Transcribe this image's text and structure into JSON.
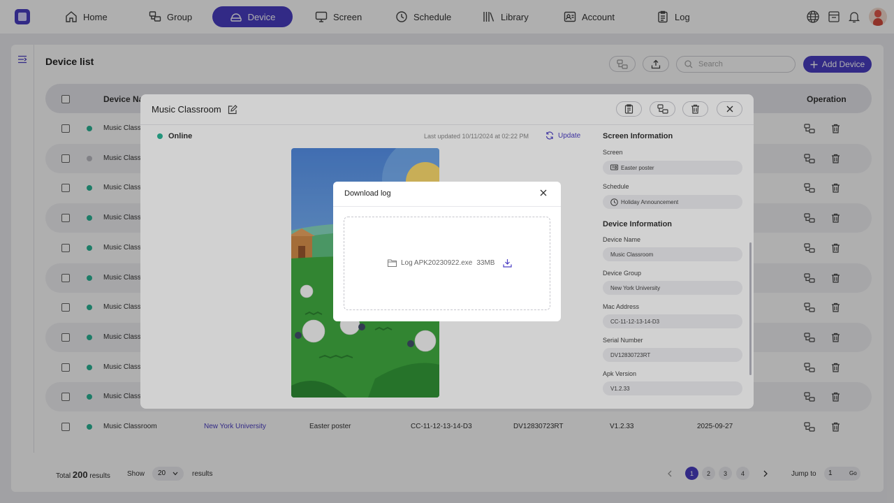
{
  "nav": {
    "items": [
      {
        "label": "Home",
        "icon": "home-icon"
      },
      {
        "label": "Group",
        "icon": "group-icon"
      },
      {
        "label": "Device",
        "icon": "device-icon",
        "active": true
      },
      {
        "label": "Screen",
        "icon": "screen-icon"
      },
      {
        "label": "Schedule",
        "icon": "schedule-icon"
      },
      {
        "label": "Library",
        "icon": "library-icon"
      },
      {
        "label": "Account",
        "icon": "account-icon"
      },
      {
        "label": "Log",
        "icon": "log-icon"
      }
    ],
    "right_icons": [
      "globe-icon",
      "store-icon",
      "bell-icon",
      "avatar"
    ]
  },
  "page": {
    "title": "Device list",
    "search_placeholder": "Search",
    "add_device_label": "Add Device"
  },
  "table": {
    "headers": {
      "device_name": "Device Nam",
      "operation": "Operation"
    },
    "rows": [
      {
        "status": "online",
        "name": "Music Classroom"
      },
      {
        "status": "offline",
        "name": "Music Classroom"
      },
      {
        "status": "online",
        "name": "Music Classroom"
      },
      {
        "status": "online",
        "name": "Music Classroom"
      },
      {
        "status": "online",
        "name": "Music Classroom"
      },
      {
        "status": "online",
        "name": "Music Classroom"
      },
      {
        "status": "online",
        "name": "Music Classroom"
      },
      {
        "status": "online",
        "name": "Music Classroom"
      },
      {
        "status": "online",
        "name": "Music Classroom"
      },
      {
        "status": "online",
        "name": "Music Classroom"
      },
      {
        "status": "online",
        "name": "Music Classroom",
        "group": "New York University",
        "screen": "Easter poster",
        "mac": "CC-11-12-13-14-D3",
        "serial": "DV12830723RT",
        "apk": "V1.2.33",
        "date": "2025-09-27"
      }
    ]
  },
  "footer": {
    "total_prefix": "Total",
    "total": "200",
    "total_suffix": "results",
    "show_label": "Show",
    "page_size": "20",
    "results_label": "results",
    "pages": [
      "1",
      "2",
      "3",
      "4"
    ],
    "current_page": "1",
    "jump_label": "Jump to",
    "jump_value": "1",
    "go_label": "Go"
  },
  "colors": {
    "accent": "#4b3ec4",
    "online": "#2bb597",
    "offline": "#bdbdc4"
  },
  "device_modal": {
    "title": "Music Classroom",
    "status": "Online",
    "last_updated": "Last updated 10/11/2024 at 02:22 PM",
    "update_label": "Update",
    "screen_info_title": "Screen Information",
    "screen_label": "Screen",
    "screen_value": "Easter poster",
    "schedule_label": "Schedule",
    "schedule_value": "Holiday Announcement",
    "device_info_title": "Device Information",
    "device_name_label": "Device Name",
    "device_name_value": "Music Classroom",
    "device_group_label": "Device Group",
    "device_group_value": "New York University",
    "mac_label": "Mac Address",
    "mac_value": "CC-11-12-13-14-D3",
    "serial_label": "Serial Number",
    "serial_value": "DV12830723RT",
    "apk_label": "Apk Version",
    "apk_value": "V1.2.33"
  },
  "download_dialog": {
    "title": "Download log",
    "file_name": "Log APK20230922.exe",
    "file_size": "33MB"
  }
}
